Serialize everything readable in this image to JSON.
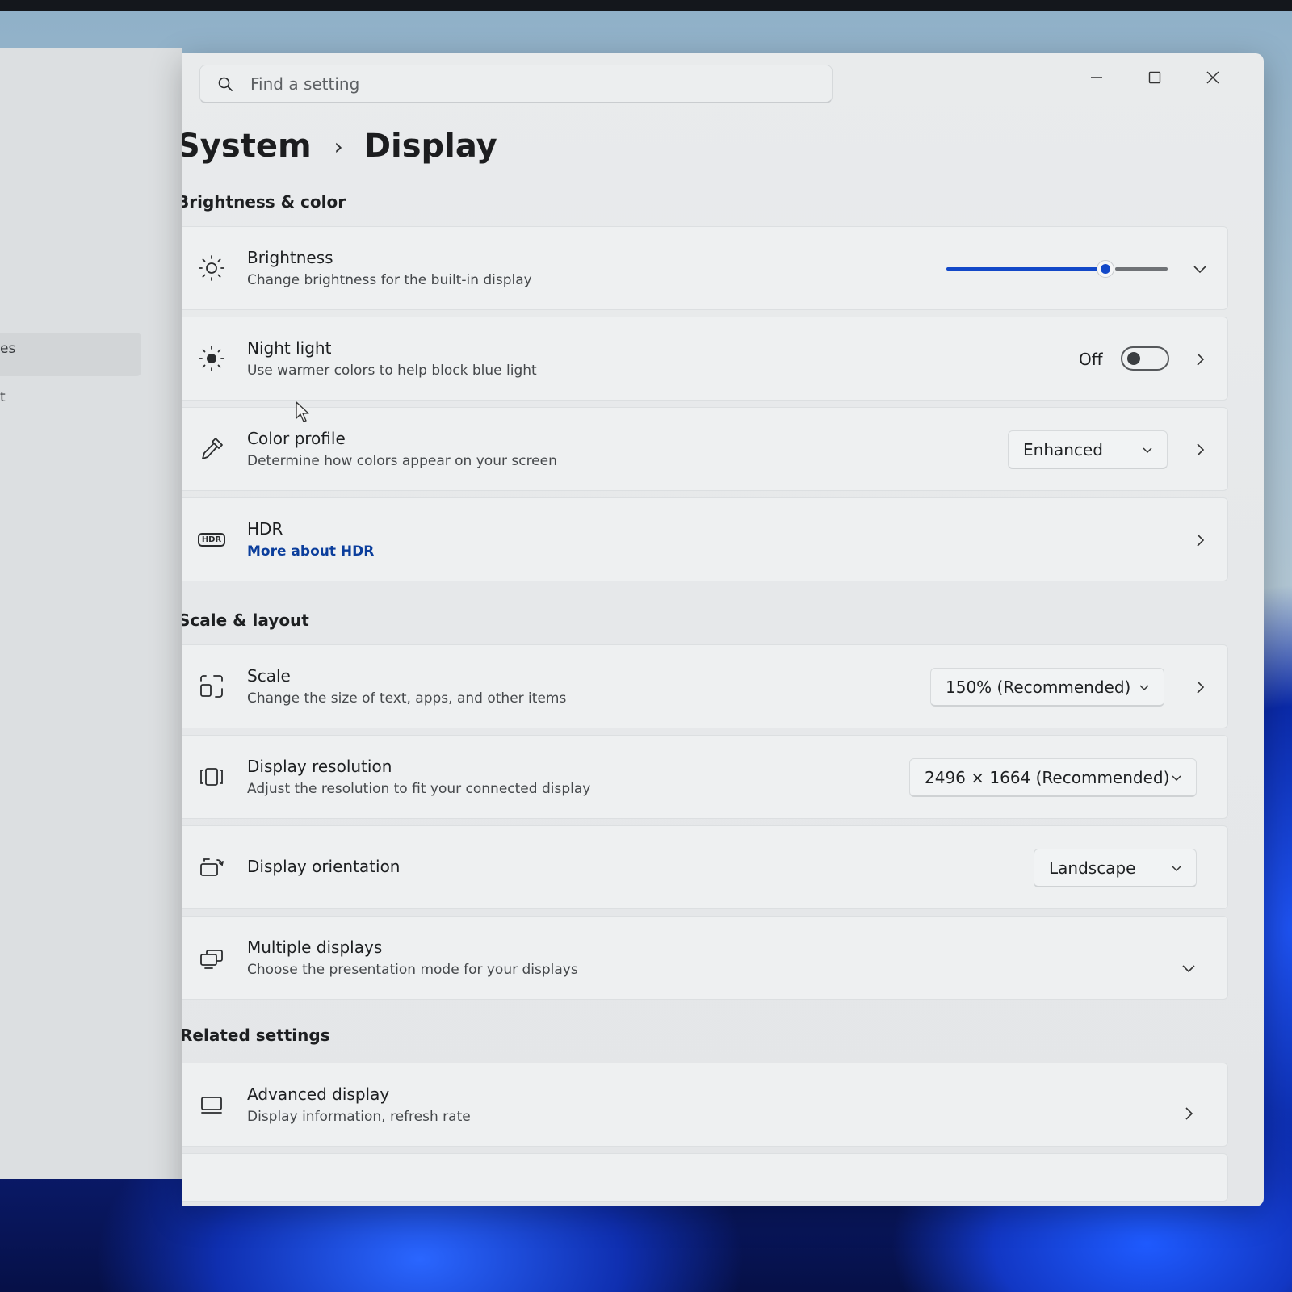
{
  "window": {
    "search_placeholder": "Find a setting",
    "controls": {
      "minimize": "minimize-icon",
      "maximize": "maximize-icon",
      "close": "close-icon"
    }
  },
  "sidebar": {
    "fragments": [
      "es",
      "t"
    ]
  },
  "breadcrumb": {
    "parent": "System",
    "separator": "›",
    "current": "Display"
  },
  "sections": {
    "brightness_color": "Brightness & color",
    "scale_layout": "Scale & layout",
    "related": "Related settings"
  },
  "brightness": {
    "title": "Brightness",
    "subtitle": "Change brightness for the built-in display",
    "level": 0.72
  },
  "night_light": {
    "title": "Night light",
    "subtitle": "Use warmer colors to help block blue light",
    "state": "Off"
  },
  "color_profile": {
    "title": "Color profile",
    "subtitle": "Determine how colors appear on your screen",
    "value": "Enhanced"
  },
  "hdr": {
    "title": "HDR",
    "link": "More about HDR",
    "icon_text": "HDR"
  },
  "scale": {
    "title": "Scale",
    "subtitle": "Change the size of text, apps, and other items",
    "value": "150% (Recommended)"
  },
  "resolution": {
    "title": "Display resolution",
    "subtitle": "Adjust the resolution to fit your connected display",
    "value": "2496 × 1664 (Recommended)"
  },
  "orientation": {
    "title": "Display orientation",
    "value": "Landscape"
  },
  "multiple_displays": {
    "title": "Multiple displays",
    "subtitle": "Choose the presentation mode for your displays"
  },
  "advanced_display": {
    "title": "Advanced display",
    "subtitle": "Display information, refresh rate"
  },
  "colors": {
    "accent": "#1248c8",
    "link": "#0b3e9c",
    "card": "#eef0f1"
  }
}
